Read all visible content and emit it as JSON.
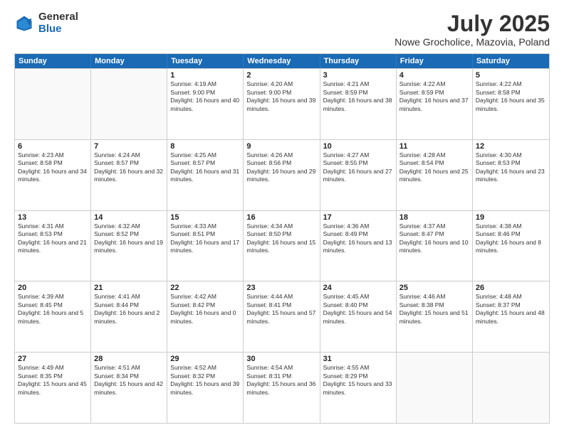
{
  "header": {
    "logo": {
      "general": "General",
      "blue": "Blue"
    },
    "title": "July 2025",
    "location": "Nowe Grocholice, Mazovia, Poland"
  },
  "weekdays": [
    "Sunday",
    "Monday",
    "Tuesday",
    "Wednesday",
    "Thursday",
    "Friday",
    "Saturday"
  ],
  "rows": [
    [
      {
        "day": "",
        "info": ""
      },
      {
        "day": "",
        "info": ""
      },
      {
        "day": "1",
        "info": "Sunrise: 4:19 AM\nSunset: 9:00 PM\nDaylight: 16 hours and 40 minutes."
      },
      {
        "day": "2",
        "info": "Sunrise: 4:20 AM\nSunset: 9:00 PM\nDaylight: 16 hours and 39 minutes."
      },
      {
        "day": "3",
        "info": "Sunrise: 4:21 AM\nSunset: 8:59 PM\nDaylight: 16 hours and 38 minutes."
      },
      {
        "day": "4",
        "info": "Sunrise: 4:22 AM\nSunset: 8:59 PM\nDaylight: 16 hours and 37 minutes."
      },
      {
        "day": "5",
        "info": "Sunrise: 4:22 AM\nSunset: 8:58 PM\nDaylight: 16 hours and 35 minutes."
      }
    ],
    [
      {
        "day": "6",
        "info": "Sunrise: 4:23 AM\nSunset: 8:58 PM\nDaylight: 16 hours and 34 minutes."
      },
      {
        "day": "7",
        "info": "Sunrise: 4:24 AM\nSunset: 8:57 PM\nDaylight: 16 hours and 32 minutes."
      },
      {
        "day": "8",
        "info": "Sunrise: 4:25 AM\nSunset: 8:57 PM\nDaylight: 16 hours and 31 minutes."
      },
      {
        "day": "9",
        "info": "Sunrise: 4:26 AM\nSunset: 8:56 PM\nDaylight: 16 hours and 29 minutes."
      },
      {
        "day": "10",
        "info": "Sunrise: 4:27 AM\nSunset: 8:55 PM\nDaylight: 16 hours and 27 minutes."
      },
      {
        "day": "11",
        "info": "Sunrise: 4:28 AM\nSunset: 8:54 PM\nDaylight: 16 hours and 25 minutes."
      },
      {
        "day": "12",
        "info": "Sunrise: 4:30 AM\nSunset: 8:53 PM\nDaylight: 16 hours and 23 minutes."
      }
    ],
    [
      {
        "day": "13",
        "info": "Sunrise: 4:31 AM\nSunset: 8:53 PM\nDaylight: 16 hours and 21 minutes."
      },
      {
        "day": "14",
        "info": "Sunrise: 4:32 AM\nSunset: 8:52 PM\nDaylight: 16 hours and 19 minutes."
      },
      {
        "day": "15",
        "info": "Sunrise: 4:33 AM\nSunset: 8:51 PM\nDaylight: 16 hours and 17 minutes."
      },
      {
        "day": "16",
        "info": "Sunrise: 4:34 AM\nSunset: 8:50 PM\nDaylight: 16 hours and 15 minutes."
      },
      {
        "day": "17",
        "info": "Sunrise: 4:36 AM\nSunset: 8:49 PM\nDaylight: 16 hours and 13 minutes."
      },
      {
        "day": "18",
        "info": "Sunrise: 4:37 AM\nSunset: 8:47 PM\nDaylight: 16 hours and 10 minutes."
      },
      {
        "day": "19",
        "info": "Sunrise: 4:38 AM\nSunset: 8:46 PM\nDaylight: 16 hours and 8 minutes."
      }
    ],
    [
      {
        "day": "20",
        "info": "Sunrise: 4:39 AM\nSunset: 8:45 PM\nDaylight: 16 hours and 5 minutes."
      },
      {
        "day": "21",
        "info": "Sunrise: 4:41 AM\nSunset: 8:44 PM\nDaylight: 16 hours and 2 minutes."
      },
      {
        "day": "22",
        "info": "Sunrise: 4:42 AM\nSunset: 8:42 PM\nDaylight: 16 hours and 0 minutes."
      },
      {
        "day": "23",
        "info": "Sunrise: 4:44 AM\nSunset: 8:41 PM\nDaylight: 15 hours and 57 minutes."
      },
      {
        "day": "24",
        "info": "Sunrise: 4:45 AM\nSunset: 8:40 PM\nDaylight: 15 hours and 54 minutes."
      },
      {
        "day": "25",
        "info": "Sunrise: 4:46 AM\nSunset: 8:38 PM\nDaylight: 15 hours and 51 minutes."
      },
      {
        "day": "26",
        "info": "Sunrise: 4:48 AM\nSunset: 8:37 PM\nDaylight: 15 hours and 48 minutes."
      }
    ],
    [
      {
        "day": "27",
        "info": "Sunrise: 4:49 AM\nSunset: 8:35 PM\nDaylight: 15 hours and 45 minutes."
      },
      {
        "day": "28",
        "info": "Sunrise: 4:51 AM\nSunset: 8:34 PM\nDaylight: 15 hours and 42 minutes."
      },
      {
        "day": "29",
        "info": "Sunrise: 4:52 AM\nSunset: 8:32 PM\nDaylight: 15 hours and 39 minutes."
      },
      {
        "day": "30",
        "info": "Sunrise: 4:54 AM\nSunset: 8:31 PM\nDaylight: 15 hours and 36 minutes."
      },
      {
        "day": "31",
        "info": "Sunrise: 4:55 AM\nSunset: 8:29 PM\nDaylight: 15 hours and 33 minutes."
      },
      {
        "day": "",
        "info": ""
      },
      {
        "day": "",
        "info": ""
      }
    ]
  ]
}
